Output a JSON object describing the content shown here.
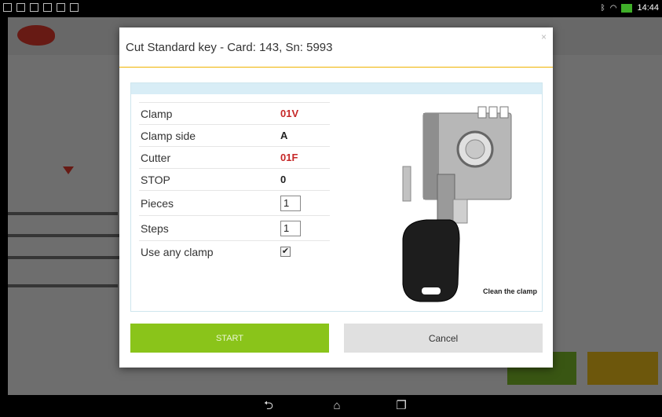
{
  "status_bar": {
    "time": "14:44",
    "icons": [
      "screenshot-icon",
      "screenshot-icon",
      "card-icon",
      "usb-icon",
      "tools-icon",
      "android-icon"
    ],
    "right_icons": [
      "bluetooth-icon",
      "wifi-icon",
      "battery-charging-icon"
    ]
  },
  "dialog": {
    "title": "Cut Standard key - Card: 143, Sn: 5993",
    "close_symbol": "×",
    "params": [
      {
        "label": "Clamp",
        "value": "01V",
        "accent": "#c62828"
      },
      {
        "label": "Clamp side",
        "value": "A"
      },
      {
        "label": "Cutter",
        "value": "01F",
        "accent": "#c62828"
      },
      {
        "label": "STOP",
        "value": "0"
      }
    ],
    "pieces": {
      "label": "Pieces",
      "value": "1"
    },
    "steps": {
      "label": "Steps",
      "value": "1"
    },
    "use_any_clamp": {
      "label": "Use any clamp",
      "checked": true,
      "mark": "✔"
    },
    "image_caption": "Clean the clamp",
    "start_label": "START",
    "cancel_label": "Cancel"
  },
  "colors": {
    "accent_rule": "#f0b400",
    "start_button": "#8ac41a",
    "cancel_button": "#e0e0e0",
    "panel_header": "#d8edf6",
    "value_red": "#c62828"
  },
  "navigation": {
    "back": "⮌",
    "home": "⌂",
    "recents": "❐"
  }
}
